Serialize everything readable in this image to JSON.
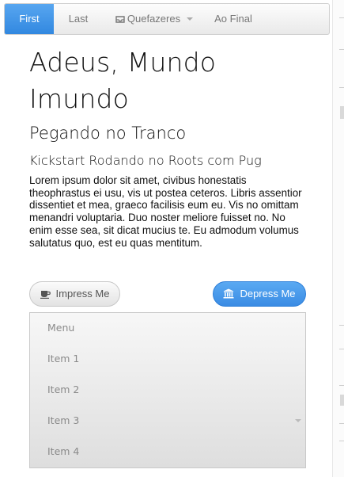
{
  "nav": {
    "items": [
      {
        "label": "First",
        "active": true
      },
      {
        "label": "Last",
        "active": false
      },
      {
        "label": "Quefazeres",
        "active": false,
        "icon": "inbox-icon",
        "dropdown": true
      },
      {
        "label": "Ao Final",
        "active": false
      }
    ]
  },
  "content": {
    "title": "Adeus, Mundo Imundo",
    "subtitle": "Pegando no Tranco",
    "lead": "Kickstart Rodando no Roots com Pug",
    "body": "Lorem ipsum dolor sit amet, civibus honestatis theophrastus ei usu, vis ut postea ceteros. Libris assentior dissentiet et mea, graeco facilisis eum eu. Vis no omittam menandri voluptaria. Duo noster meliore fuisset no. No enim esse sea, sit dicat mucius te. Eu admodum volumus salutatus quo, est eu quas mentitum."
  },
  "buttons": {
    "impress": {
      "label": "Impress Me",
      "icon": "coffee-icon"
    },
    "depress": {
      "label": "Depress Me",
      "icon": "bank-icon"
    }
  },
  "menu": {
    "items": [
      "Menu",
      "Item 1",
      "Item 2",
      "Item 3",
      "Item 4"
    ]
  },
  "colors": {
    "accent": "#3d93e8"
  }
}
